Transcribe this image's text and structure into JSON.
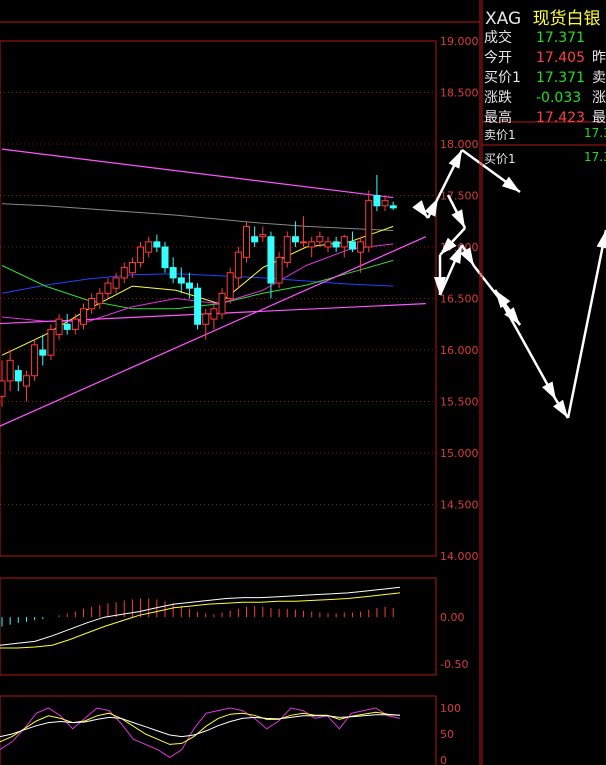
{
  "colors": {
    "up": "#ff3b3b",
    "down": "#33ffff",
    "grid": "#b01818",
    "axis_text": "#d83c3c",
    "ma5": "#ffffff",
    "ma10": "#ffff33",
    "ma20": "#dd33dd",
    "ma30": "#33dd33",
    "ma60": "#2244ff",
    "ma_long": "#888888",
    "trend": "#ff55ff",
    "arrow": "#ffffff"
  },
  "quote": {
    "symbol": "XAG",
    "name": "现货白银",
    "rows": [
      {
        "label": "成交",
        "value": "17.371",
        "color": "#22dd22",
        "label2": ""
      },
      {
        "label": "今开",
        "value": "17.405",
        "color": "#ff4040",
        "label2": "昨"
      },
      {
        "label": "买价1",
        "value": "17.371",
        "color": "#22dd22",
        "label2": "卖"
      },
      {
        "label": "涨跌",
        "value": "-0.033",
        "color": "#22dd22",
        "label2": "涨"
      },
      {
        "label": "最高",
        "value": "17.423",
        "color": "#ff4040",
        "label2": "最"
      }
    ],
    "orderbook": [
      {
        "label": "卖价1",
        "value": "17.3"
      },
      {
        "label": "买价1",
        "value": "17.3"
      }
    ]
  },
  "chart_data": [
    {
      "type": "candlestick",
      "title": "",
      "y_ticks": [
        "19.000",
        "18.500",
        "18.000",
        "17.500",
        "17.000",
        "16.500",
        "16.000",
        "15.500",
        "15.000",
        "14.500",
        "14.000"
      ],
      "ylim": [
        14.0,
        19.0
      ],
      "candles": [
        [
          15.55,
          15.9,
          15.45,
          15.7
        ],
        [
          15.7,
          16.0,
          15.6,
          15.9
        ],
        [
          15.8,
          15.85,
          15.6,
          15.7
        ],
        [
          15.65,
          15.8,
          15.5,
          15.75
        ],
        [
          15.75,
          16.1,
          15.7,
          16.05
        ],
        [
          16.0,
          16.15,
          15.85,
          15.95
        ],
        [
          15.95,
          16.25,
          15.9,
          16.2
        ],
        [
          16.15,
          16.35,
          16.1,
          16.3
        ],
        [
          16.25,
          16.35,
          16.15,
          16.2
        ],
        [
          16.2,
          16.35,
          16.15,
          16.3
        ],
        [
          16.25,
          16.45,
          16.2,
          16.4
        ],
        [
          16.4,
          16.55,
          16.35,
          16.5
        ],
        [
          16.45,
          16.6,
          16.4,
          16.55
        ],
        [
          16.55,
          16.7,
          16.5,
          16.65
        ],
        [
          16.6,
          16.75,
          16.55,
          16.7
        ],
        [
          16.7,
          16.85,
          16.65,
          16.8
        ],
        [
          16.75,
          16.9,
          16.7,
          16.85
        ],
        [
          16.85,
          17.05,
          16.8,
          17.0
        ],
        [
          16.95,
          17.1,
          16.9,
          17.05
        ],
        [
          17.05,
          17.12,
          16.95,
          17.0
        ],
        [
          17.0,
          17.05,
          16.75,
          16.8
        ],
        [
          16.8,
          16.9,
          16.65,
          16.7
        ],
        [
          16.7,
          16.8,
          16.55,
          16.65
        ],
        [
          16.65,
          16.75,
          16.5,
          16.6
        ],
        [
          16.6,
          16.65,
          16.2,
          16.25
        ],
        [
          16.25,
          16.4,
          16.1,
          16.35
        ],
        [
          16.3,
          16.45,
          16.2,
          16.4
        ],
        [
          16.35,
          16.6,
          16.3,
          16.55
        ],
        [
          16.5,
          16.8,
          16.45,
          16.75
        ],
        [
          16.7,
          17.0,
          16.6,
          16.95
        ],
        [
          16.9,
          17.25,
          16.85,
          17.2
        ],
        [
          17.1,
          17.2,
          17.0,
          17.05
        ],
        [
          17.1,
          17.2,
          17.05,
          17.12
        ],
        [
          17.1,
          17.15,
          16.5,
          16.65
        ],
        [
          16.65,
          16.95,
          16.6,
          16.9
        ],
        [
          16.85,
          17.15,
          16.8,
          17.1
        ],
        [
          17.1,
          17.25,
          17.0,
          17.05
        ],
        [
          17.05,
          17.3,
          17.0,
          17.05
        ],
        [
          17.0,
          17.1,
          16.9,
          17.05
        ],
        [
          17.05,
          17.15,
          17.0,
          17.1
        ],
        [
          17.0,
          17.1,
          16.95,
          17.05
        ],
        [
          17.05,
          17.1,
          16.95,
          17.0
        ],
        [
          17.0,
          17.12,
          16.9,
          17.1
        ],
        [
          17.05,
          17.15,
          16.95,
          16.98
        ],
        [
          16.95,
          17.1,
          16.75,
          17.05
        ],
        [
          17.0,
          17.55,
          16.95,
          17.45
        ],
        [
          17.5,
          17.7,
          17.35,
          17.4
        ],
        [
          17.4,
          17.5,
          17.35,
          17.45
        ],
        [
          17.4,
          17.44,
          17.36,
          17.38
        ]
      ],
      "moving_averages": [
        {
          "color_key": "ma60",
          "values": [
            16.55,
            16.63,
            16.69,
            16.73,
            16.74,
            16.72,
            16.7,
            16.67,
            16.64,
            16.62
          ]
        },
        {
          "color_key": "ma_long",
          "values": [
            17.42,
            17.4,
            17.37,
            17.34,
            17.31,
            17.27,
            17.23,
            17.2,
            17.18,
            17.16
          ]
        },
        {
          "color_key": "ma30",
          "values": [
            16.82,
            16.62,
            16.48,
            16.4,
            16.4,
            16.45,
            16.55,
            16.63,
            16.75,
            16.87
          ]
        },
        {
          "color_key": "ma10",
          "values": [
            15.95,
            16.15,
            16.4,
            16.62,
            16.58,
            16.45,
            16.8,
            17.0,
            17.05,
            17.2
          ]
        },
        {
          "color_key": "ma20",
          "values": [
            16.32,
            16.28,
            16.28,
            16.42,
            16.5,
            16.45,
            16.58,
            16.82,
            16.98,
            17.03
          ]
        }
      ],
      "trendlines": [
        {
          "color_key": "trend",
          "from": [
            0,
            17.95
          ],
          "to": [
            48,
            17.48
          ]
        },
        {
          "color_key": "trend",
          "from": [
            -2,
            15.2
          ],
          "to": [
            52,
            17.1
          ]
        },
        {
          "color_key": "trend",
          "from": [
            -2,
            16.25
          ],
          "to": [
            52,
            16.45
          ]
        }
      ]
    },
    {
      "type": "bar",
      "title": "",
      "y_ticks": [
        "0.00",
        "-0.50"
      ],
      "ylim": [
        -0.62,
        0.42
      ],
      "values": [
        -0.1,
        -0.08,
        -0.06,
        -0.05,
        -0.03,
        -0.02,
        0.0,
        0.02,
        0.04,
        0.06,
        0.09,
        0.11,
        0.13,
        0.15,
        0.16,
        0.18,
        0.19,
        0.2,
        0.2,
        0.19,
        0.17,
        0.15,
        0.12,
        0.09,
        0.06,
        0.04,
        0.03,
        0.05,
        0.07,
        0.09,
        0.11,
        0.12,
        0.11,
        0.1,
        0.09,
        0.09,
        0.08,
        0.07,
        0.06,
        0.05,
        0.04,
        0.04,
        0.05,
        0.05,
        0.06,
        0.08,
        0.1,
        0.11,
        0.1
      ],
      "series": [
        {
          "color_key": "ma5",
          "values": [
            -0.3,
            -0.28,
            -0.26,
            -0.2,
            -0.13,
            -0.06,
            0.0,
            0.03,
            0.06,
            0.1,
            0.14,
            0.16,
            0.18,
            0.2,
            0.21,
            0.21,
            0.22,
            0.23,
            0.24,
            0.25,
            0.26,
            0.28,
            0.3,
            0.32
          ]
        },
        {
          "color_key": "ma10",
          "values": [
            -0.33,
            -0.33,
            -0.32,
            -0.3,
            -0.24,
            -0.17,
            -0.1,
            -0.04,
            0.02,
            0.06,
            0.1,
            0.12,
            0.14,
            0.15,
            0.16,
            0.16,
            0.17,
            0.17,
            0.18,
            0.19,
            0.2,
            0.22,
            0.24,
            0.26
          ]
        }
      ]
    },
    {
      "type": "line",
      "title": "",
      "y_ticks": [
        "100",
        "50",
        "0"
      ],
      "ylim": [
        0,
        100
      ],
      "series": [
        {
          "color_key": "ma20",
          "values": [
            20,
            35,
            60,
            90,
            100,
            85,
            60,
            80,
            100,
            95,
            70,
            40,
            30,
            20,
            5,
            20,
            60,
            90,
            95,
            100,
            95,
            80,
            60,
            75,
            100,
            95,
            80,
            85,
            60,
            90,
            95,
            100,
            85,
            80
          ]
        },
        {
          "color_key": "ma10",
          "values": [
            35,
            45,
            60,
            75,
            85,
            80,
            72,
            75,
            85,
            90,
            80,
            65,
            50,
            40,
            30,
            32,
            45,
            65,
            80,
            88,
            90,
            86,
            78,
            78,
            86,
            90,
            86,
            86,
            78,
            84,
            88,
            92,
            88,
            86
          ]
        },
        {
          "color_key": "ma5",
          "values": [
            45,
            50,
            58,
            66,
            72,
            74,
            72,
            73,
            78,
            82,
            80,
            72,
            64,
            56,
            48,
            45,
            48,
            56,
            66,
            74,
            80,
            82,
            80,
            79,
            82,
            85,
            85,
            85,
            82,
            83,
            85,
            87,
            87,
            86
          ]
        }
      ]
    }
  ]
}
